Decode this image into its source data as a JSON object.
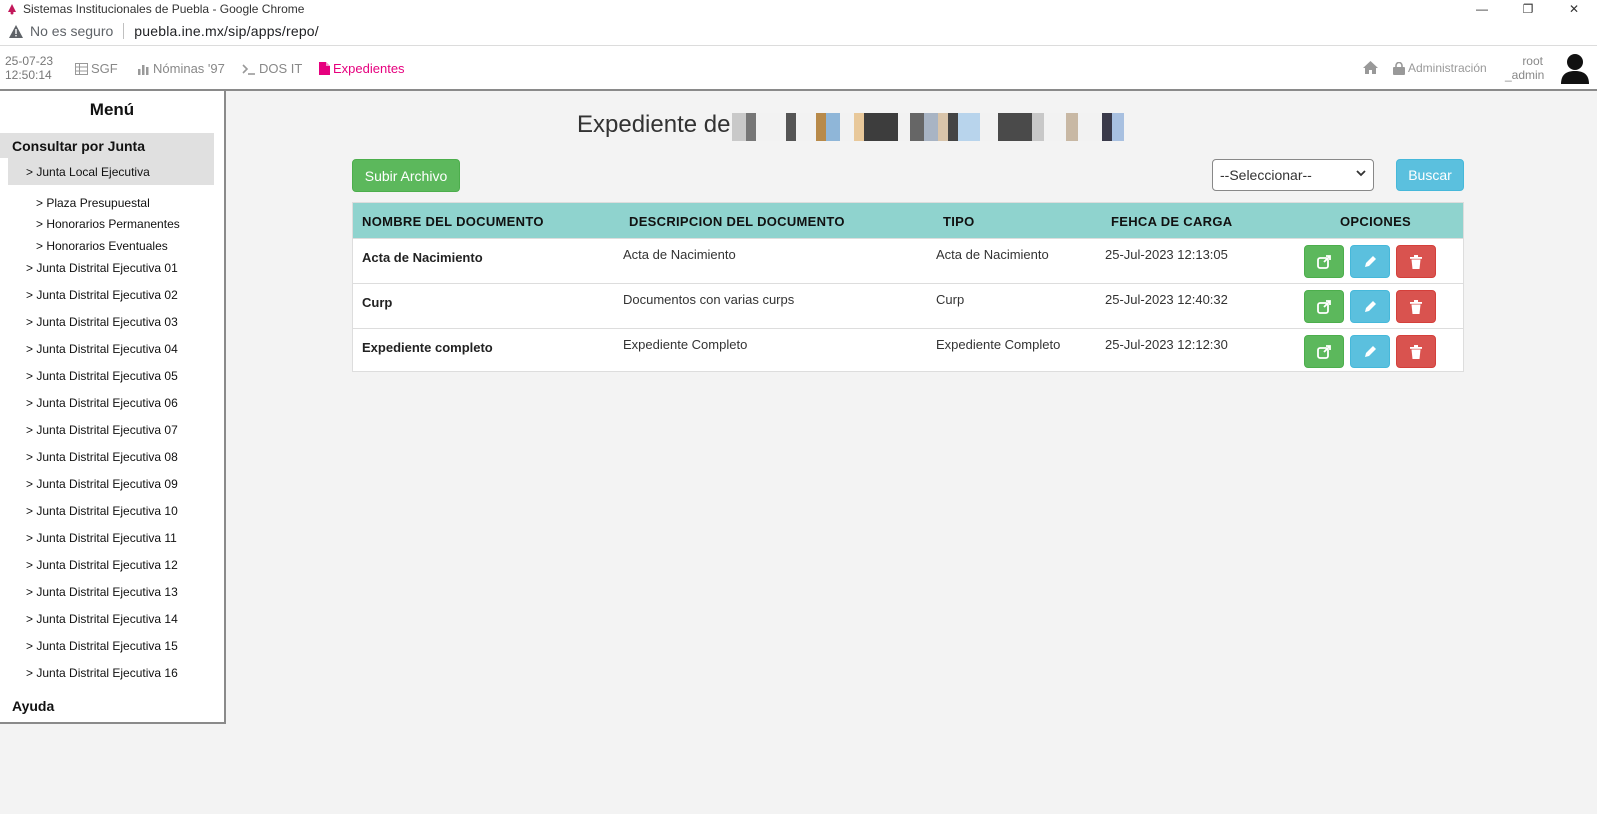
{
  "window": {
    "title": "Sistemas Institucionales de Puebla - Google Chrome"
  },
  "address_bar": {
    "security_text": "No es seguro",
    "url": "puebla.ine.mx/sip/apps/repo/"
  },
  "navbar": {
    "date": "25-07-23",
    "time": "12:50:14",
    "items": [
      {
        "label": "SGF",
        "icon": "table-icon"
      },
      {
        "label": "Nóminas '97",
        "icon": "bar-chart-icon"
      },
      {
        "label": "DOS IT",
        "icon": "terminal-icon"
      },
      {
        "label": "Expedientes",
        "icon": "file-icon",
        "active": true
      }
    ],
    "admin_label": "Administración",
    "user_line1": "root",
    "user_line2": "_admin",
    "active_color": "#e6007e"
  },
  "sidebar": {
    "title": "Menú",
    "section": "Consultar por Junta",
    "junta_local": "> Junta Local Ejecutiva",
    "sub_items": [
      "> Plaza Presupuestal",
      "> Honorarios Permanentes",
      "> Honorarios Eventuales"
    ],
    "juntas": [
      "> Junta Distrital Ejecutiva 01",
      "> Junta Distrital Ejecutiva 02",
      "> Junta Distrital Ejecutiva 03",
      "> Junta Distrital Ejecutiva 04",
      "> Junta Distrital Ejecutiva 05",
      "> Junta Distrital Ejecutiva 06",
      "> Junta Distrital Ejecutiva 07",
      "> Junta Distrital Ejecutiva 08",
      "> Junta Distrital Ejecutiva 09",
      "> Junta Distrital Ejecutiva 10",
      "> Junta Distrital Ejecutiva 11",
      "> Junta Distrital Ejecutiva 12",
      "> Junta Distrital Ejecutiva 13",
      "> Junta Distrital Ejecutiva 14",
      "> Junta Distrital Ejecutiva 15",
      "> Junta Distrital Ejecutiva 16"
    ],
    "help": "Ayuda"
  },
  "main": {
    "title": "Expediente de",
    "upload_button": "Subir Archivo",
    "select_value": "--Seleccionar--",
    "search_button": "Buscar",
    "table": {
      "headers": [
        "NOMBRE DEL DOCUMENTO",
        "DESCRIPCION DEL DOCUMENTO",
        "TIPO",
        "FEHCA DE CARGA",
        "OPCIONES"
      ],
      "rows": [
        {
          "name": "Acta de Nacimiento",
          "description": "Acta de Nacimiento",
          "type": "Acta de Nacimiento",
          "date": "25-Jul-2023 12:13:05"
        },
        {
          "name": "Curp",
          "description": "Documentos con varias curps",
          "type": "Curp",
          "date": "25-Jul-2023 12:40:32"
        },
        {
          "name": "Expediente completo",
          "description": "Expediente Completo",
          "type": "Expediente Completo",
          "date": "25-Jul-2023 12:12:30"
        }
      ]
    }
  },
  "colors": {
    "success": "#5cb85c",
    "info": "#5bc0de",
    "danger": "#d9534f",
    "table_header": "#8fd3ce"
  }
}
